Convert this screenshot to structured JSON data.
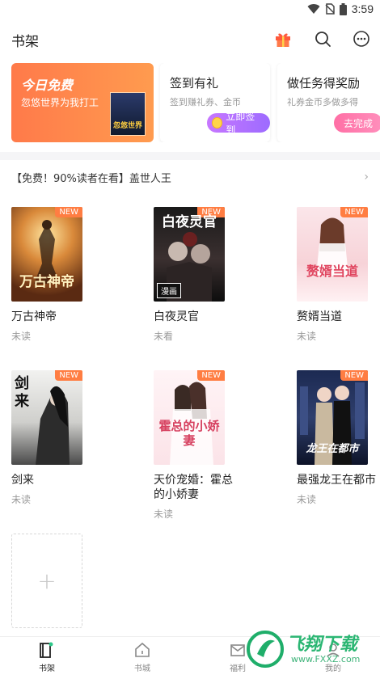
{
  "status_bar": {
    "time": "3:59"
  },
  "header": {
    "title": "书架"
  },
  "cards": {
    "free": {
      "title": "今日免费",
      "subtitle": "忽悠世界为我打工",
      "cover_text": "忽悠世界"
    },
    "sign": {
      "title": "签到有礼",
      "subtitle": "签到赚礼券、金币",
      "button": "立即签到"
    },
    "task": {
      "title": "做任务得奖励",
      "subtitle": "礼券金币多做多得",
      "button": "去完成"
    }
  },
  "recommend": {
    "text": "【免费！90%读者在看】盖世人王",
    "arrow": "›"
  },
  "books": [
    {
      "title": "万古神帝",
      "status": "未读",
      "badge": "NEW",
      "cover_text": "万古神帝"
    },
    {
      "title": "白夜灵官",
      "status": "未看",
      "badge": "NEW",
      "cover_text": "白夜灵官",
      "cover_tag": "漫画"
    },
    {
      "title": "赘婿当道",
      "status": "未读",
      "badge": "NEW",
      "cover_text": "赘婿当道"
    },
    {
      "title": "剑来",
      "status": "未读",
      "badge": "NEW",
      "cover_text": "剑来"
    },
    {
      "title": "天价宠婚：霍总的小娇妻",
      "status": "未读",
      "badge": "NEW",
      "cover_text": "霍总的小娇妻"
    },
    {
      "title": "最强龙王在都市",
      "status": "未读",
      "badge": "NEW",
      "cover_text": "龙王在都市"
    }
  ],
  "add_book": {
    "symbol": "+"
  },
  "tabs": [
    {
      "label": "书架",
      "icon": "bookshelf-icon"
    },
    {
      "label": "书城",
      "icon": "home-icon"
    },
    {
      "label": "福利",
      "icon": "mail-icon"
    },
    {
      "label": "我的",
      "icon": "user-icon"
    }
  ],
  "watermark": {
    "text": "飞翔下载",
    "url": "www.FXXZ.com"
  },
  "colors": {
    "accent": "#ff7d42",
    "purple": "#a66dff",
    "pink": "#ff7aab"
  }
}
